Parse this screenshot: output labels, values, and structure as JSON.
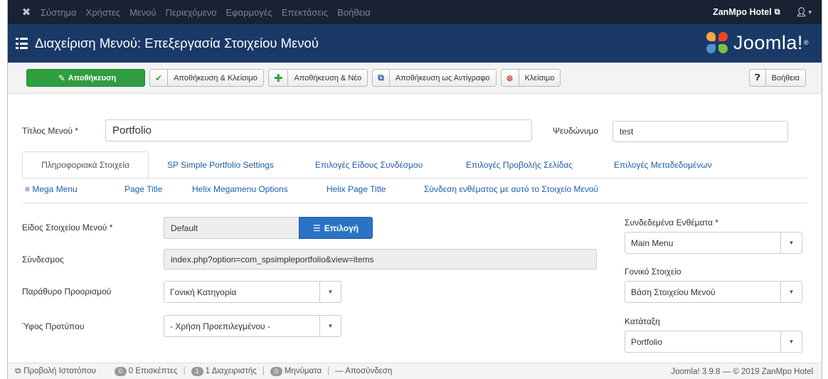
{
  "navbar": {
    "menu": [
      "Σύστημα",
      "Χρήστες",
      "Μενού",
      "Περιεχόμενο",
      "Εφαρμογές",
      "Επεκτάσεις",
      "Βοήθεια"
    ],
    "site_name": "ZanMpo Hotel",
    "site_icon": "external-link-icon",
    "user_icon": "user-icon"
  },
  "header": {
    "title": "Διαχείριση Μενού: Επεξεργασία Στοιχείου Μενού",
    "logo_text": "Joomla!",
    "logo_reg": "®"
  },
  "toolbar": {
    "save": "Αποθήκευση",
    "save_close": "Αποθήκευση & Κλείσιμο",
    "save_new": "Αποθήκευση & Νέο",
    "save_copy": "Αποθήκευση ως Αντίγραφο",
    "close": "Κλείσιμο",
    "help": "Βοήθεια"
  },
  "form": {
    "menu_title_label": "Τίτλος Μενού *",
    "menu_title_value": "Portfolio",
    "alias_label": "Ψευδώνυμο",
    "alias_value": "test"
  },
  "tabs_row1": [
    "Πληροφοριακά Στοιχεία",
    "SP Simple Portfolio Settings",
    "Επιλογές Είδους Συνδέσμου",
    "Επιλογές Προβολής Σελίδας",
    "Επιλογές Μεταδεδομένων"
  ],
  "tabs_row2": [
    "≡ Mega Menu",
    "Page Title",
    "Helix Megamenu Options",
    "Helix Page Title",
    "Σύνδεση ενθέματος με αυτό το Στοιχείο Μενού"
  ],
  "details": {
    "type_label": "Είδος Στοιχείου Μενού *",
    "type_value": "Default",
    "choose_button": "Επιλογή",
    "link_label": "Σύνδεσμος",
    "link_value": "index.php?option=com_spsimpleportfolio&view=items",
    "target_label": "Παράθυρο Προορισμού",
    "target_value": "Γονική Κατηγορία",
    "template_label": "Ύφος Προτύπου",
    "template_value": "- Χρήση Προεπιλεγμένου -"
  },
  "sidebar": {
    "menu_label": "Συνδεδεμένα Ενθέματα *",
    "menu_value": "Main Menu",
    "parent_label": "Γονικό Στοιχείο",
    "parent_value": "Βάση Στοιχείου Μενού",
    "ordering_label": "Κατάταξη",
    "ordering_value": "Portfolio"
  },
  "status": {
    "view_site": "Προβολή Ιστοτόπου",
    "visitors_count": "0",
    "visitors": "0 Επισκέπτες",
    "admins_count": "1",
    "admins": "1 Διαχειριστής",
    "messages_count": "0",
    "messages": "Μηνύματα",
    "logout": "— Αποσύνδεση",
    "version": "Joomla! 3.9.8 — © 2019 ZanMpo Hotel"
  },
  "colors": {
    "navbar": "#192232",
    "header": "#1a3967",
    "save_green": "#2e9e3e",
    "choose_blue": "#2a73c5",
    "link_blue": "#1f5ea8"
  }
}
